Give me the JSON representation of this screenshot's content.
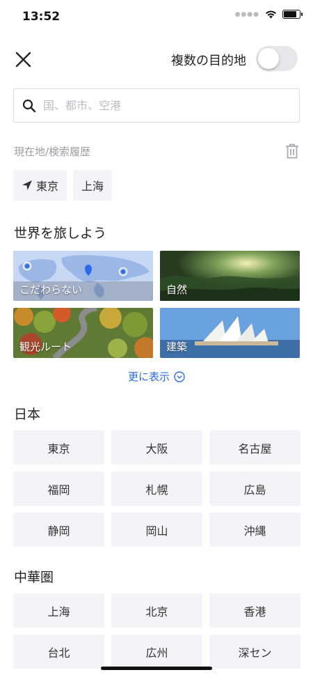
{
  "status_bar": {
    "time": "13:52"
  },
  "header": {
    "multi_destination_label": "複数の目的地",
    "multi_destination_enabled": false
  },
  "search": {
    "placeholder": "国、都市、空港"
  },
  "recent": {
    "title": "現在地/検索履歴",
    "items": [
      {
        "label": "東京",
        "icon": "location-arrow-icon"
      },
      {
        "label": "上海"
      }
    ]
  },
  "explore": {
    "title": "世界を旅しよう",
    "cards": [
      {
        "label": "こだわらない",
        "image": "world-map"
      },
      {
        "label": "自然",
        "image": "forest"
      },
      {
        "label": "観光ルート",
        "image": "autumn-road"
      },
      {
        "label": "建築",
        "image": "opera-house"
      }
    ],
    "more_label": "更に表示"
  },
  "japan": {
    "title": "日本",
    "cities": [
      "東京",
      "大阪",
      "名古屋",
      "福岡",
      "札幌",
      "広島",
      "静岡",
      "岡山",
      "沖縄"
    ]
  },
  "greater_china": {
    "title": "中華圏",
    "cities": [
      "上海",
      "北京",
      "香港",
      "台北",
      "広州",
      "深セン"
    ]
  },
  "colors": {
    "accent": "#2c6be8",
    "chip_bg": "#f3f4f7",
    "muted": "#9a9da3"
  }
}
